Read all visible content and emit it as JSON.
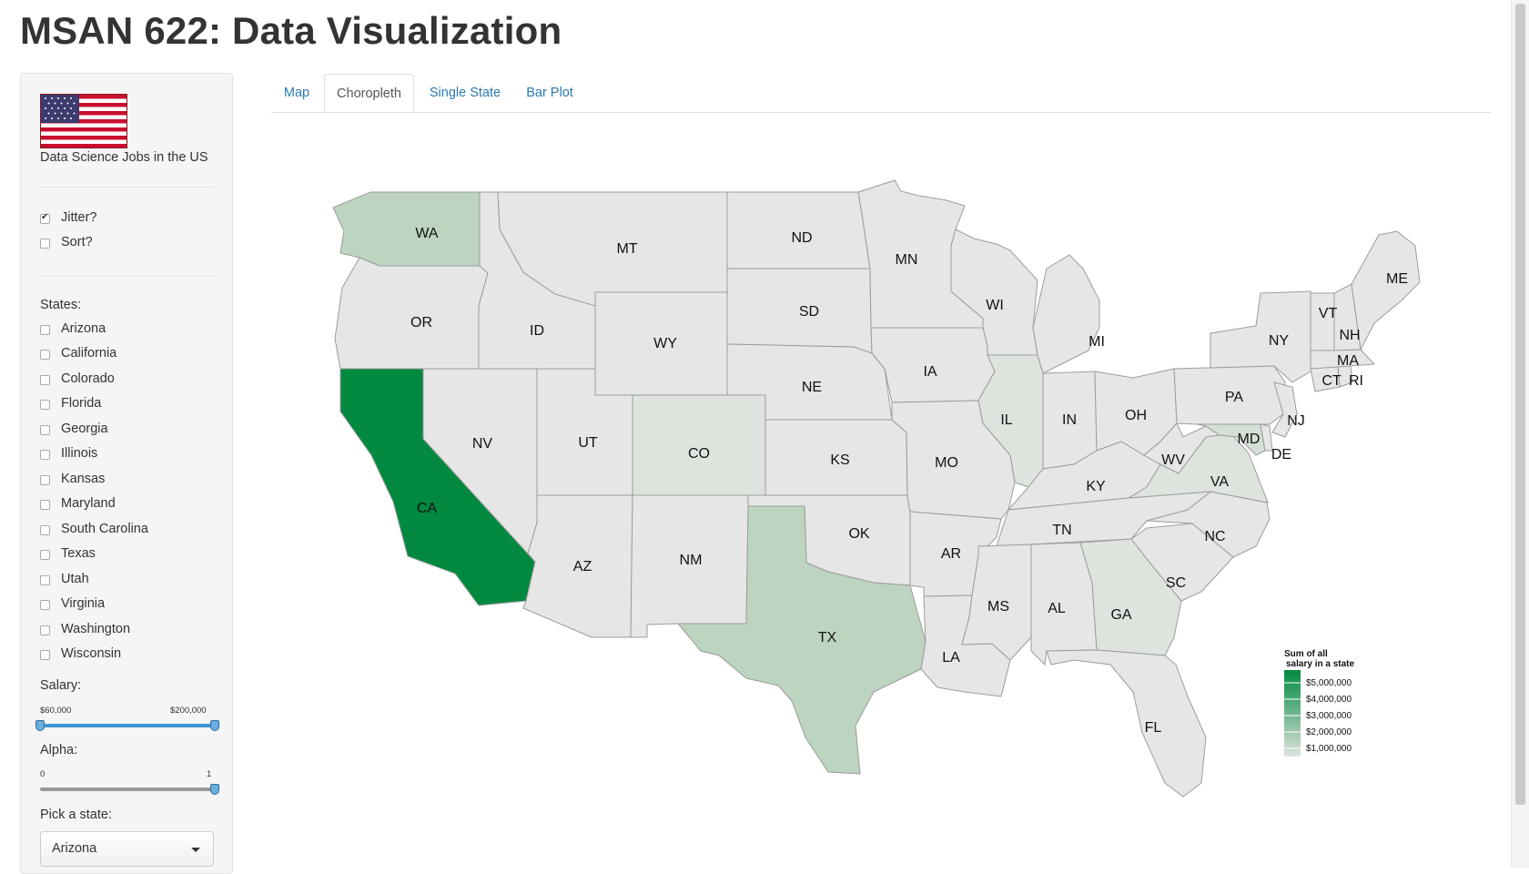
{
  "title": "MSAN 622: Data Visualization",
  "sidebar": {
    "subtitle": "Data Science Jobs in the US",
    "options": [
      {
        "label": "Jitter?",
        "checked": true
      },
      {
        "label": "Sort?",
        "checked": false
      }
    ],
    "states_label": "States:",
    "states": [
      {
        "label": "Arizona",
        "checked": false
      },
      {
        "label": "California",
        "checked": false
      },
      {
        "label": "Colorado",
        "checked": false
      },
      {
        "label": "Florida",
        "checked": false
      },
      {
        "label": "Georgia",
        "checked": false
      },
      {
        "label": "Illinois",
        "checked": false
      },
      {
        "label": "Kansas",
        "checked": false
      },
      {
        "label": "Maryland",
        "checked": false
      },
      {
        "label": "South Carolina",
        "checked": false
      },
      {
        "label": "Texas",
        "checked": false
      },
      {
        "label": "Utah",
        "checked": false
      },
      {
        "label": "Virginia",
        "checked": false
      },
      {
        "label": "Washington",
        "checked": false
      },
      {
        "label": "Wisconsin",
        "checked": false
      }
    ],
    "salary": {
      "label": "Salary:",
      "min_label": "$60,000",
      "max_label": "$200,000",
      "min": 60000,
      "max": 200000
    },
    "alpha": {
      "label": "Alpha:",
      "min_label": "0",
      "max_label": "1",
      "value": 1
    },
    "pick_label": "Pick a state:",
    "pick_value": "Arizona"
  },
  "tabs": [
    {
      "label": "Map",
      "active": false
    },
    {
      "label": "Choropleth",
      "active": true
    },
    {
      "label": "Single State",
      "active": false
    },
    {
      "label": "Bar Plot",
      "active": false
    }
  ],
  "map": {
    "legend": {
      "title_line1": "Sum of all",
      "title_line2": "salary in a state",
      "ticks": [
        "$5,000,000",
        "$4,000,000",
        "$3,000,000",
        "$2,000,000",
        "$1,000,000"
      ]
    },
    "colors": {
      "base": "#e6e6e6",
      "low": "#dde3dd",
      "light": "#d4dfd5",
      "mid": "#bcd4c0",
      "high": "#00893f",
      "border": "#9c9c9c"
    },
    "states": [
      "WA",
      "OR",
      "CA",
      "ID",
      "NV",
      "MT",
      "WY",
      "UT",
      "AZ",
      "CO",
      "NM",
      "ND",
      "SD",
      "NE",
      "KS",
      "OK",
      "TX",
      "MN",
      "IA",
      "MO",
      "AR",
      "LA",
      "WI",
      "IL",
      "MI",
      "IN",
      "OH",
      "KY",
      "TN",
      "MS",
      "AL",
      "GA",
      "FL",
      "SC",
      "NC",
      "VA",
      "WV",
      "MD",
      "DE",
      "PA",
      "NJ",
      "NY",
      "CT",
      "RI",
      "MA",
      "VT",
      "NH",
      "ME"
    ],
    "highlighted_states": {
      "CA": "high",
      "TX": "mid",
      "WA": "mid",
      "IL": "low",
      "VA": "low",
      "GA": "low",
      "MD": "light",
      "CO": "low"
    }
  }
}
